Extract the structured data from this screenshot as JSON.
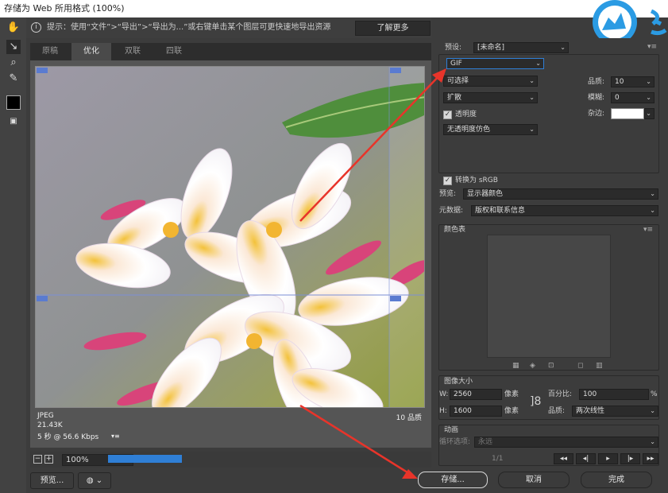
{
  "window": {
    "title": "存储为 Web 所用格式 (100%)"
  },
  "hint": {
    "info_icon": "i",
    "text": "提示：使用“文件”>“导出”>“导出为...”或右键单击某个图层可更快速地导出资源",
    "learn_more": "了解更多"
  },
  "tabs": [
    "原稿",
    "优化",
    "双联",
    "四联"
  ],
  "active_tab": "优化",
  "image_info": {
    "format": "JPEG",
    "size": "21.43K",
    "time": "5 秒 @ 56.6 Kbps",
    "quality": "10 品质"
  },
  "zoom": {
    "value": "100%"
  },
  "progress": {
    "fraction": 0.95
  },
  "left_buttons": {
    "preview": "预览..."
  },
  "dialog_buttons": {
    "save": "存储...",
    "cancel": "取消",
    "done": "完成"
  },
  "settings": {
    "preset_label": "预设:",
    "preset_value": "[未命名]",
    "format": "GIF",
    "algorithm": "可选择",
    "dither": "扩散",
    "transparency_label": "透明度",
    "transparency_checked": true,
    "matte_dither": "无透明度仿色",
    "quality_label": "品质:",
    "quality_value": "10",
    "blur_label": "模糊:",
    "blur_value": "0",
    "matte_label": "杂边:",
    "convert_srgb_label": "转换为 sRGB",
    "convert_srgb_checked": true,
    "preview_label": "预览:",
    "preview_value": "显示器颜色",
    "metadata_label": "元数据:",
    "metadata_value": "版权和联系信息"
  },
  "color_table": {
    "title": "颜色表"
  },
  "image_size": {
    "title": "图像大小",
    "w_label": "W:",
    "w_value": "2560",
    "h_label": "H:",
    "h_value": "1600",
    "unit": "像素",
    "percent_label": "百分比:",
    "percent_value": "100",
    "percent_sign": "%",
    "quality_label": "品质:",
    "quality_value": "两次线性"
  },
  "animation": {
    "title": "动画",
    "loop_label": "循环选项:",
    "loop_value": "永远",
    "frame": "1/1"
  },
  "colors": {
    "accent": "#2f7fd6",
    "arrow": "#e8342a",
    "logo": "#2b9be3"
  }
}
